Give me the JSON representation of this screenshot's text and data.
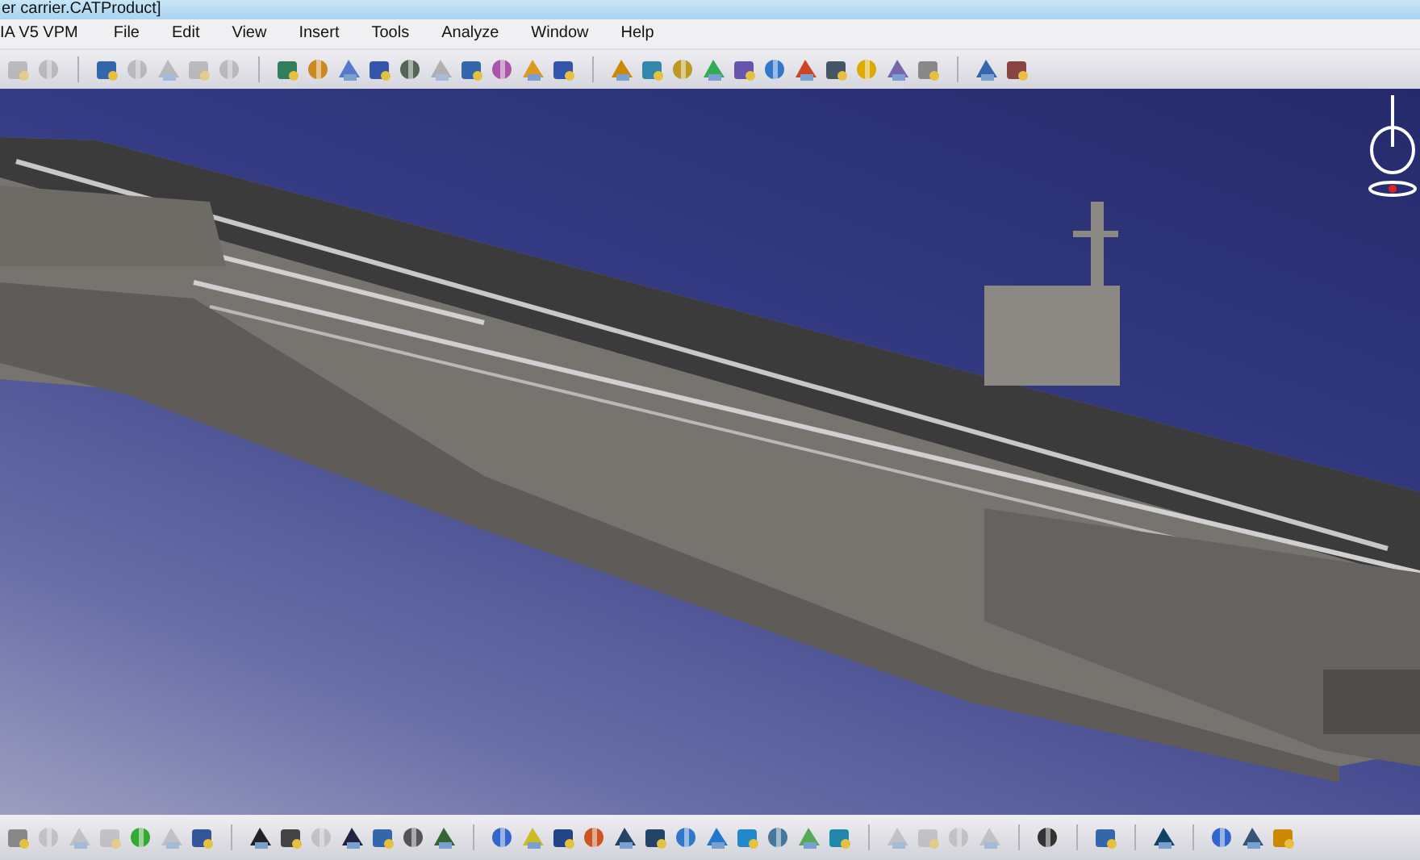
{
  "window": {
    "title": "er carrier.CATProduct]"
  },
  "menu_bar": {
    "items": [
      {
        "label": "IA V5 VPM",
        "kind": "app"
      },
      {
        "label": "File",
        "kind": "menu"
      },
      {
        "label": "Edit",
        "kind": "menu"
      },
      {
        "label": "View",
        "kind": "menu"
      },
      {
        "label": "Insert",
        "kind": "menu"
      },
      {
        "label": "Tools",
        "kind": "menu"
      },
      {
        "label": "Analyze",
        "kind": "menu"
      },
      {
        "label": "Window",
        "kind": "menu"
      },
      {
        "label": "Help",
        "kind": "menu"
      }
    ]
  }
}
